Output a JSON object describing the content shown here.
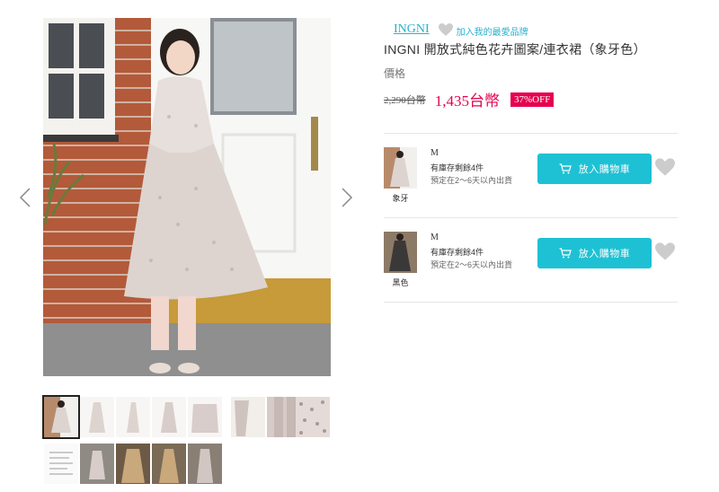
{
  "brand": {
    "name": "INGNI",
    "favorite_label": "加入我的最愛品牌"
  },
  "product": {
    "title": "INGNI 開放式純色花卉圖案/連衣裙（象牙色）",
    "price_label": "價格",
    "original_price": "2,290台幣",
    "sale_price": "1,435台幣",
    "discount": "37%OFF"
  },
  "variants": [
    {
      "color": "象牙",
      "size": "M",
      "stock": "有庫存剩餘4件",
      "eta": "預定在2～6天以內出貨",
      "cart_label": "放入購物車"
    },
    {
      "color": "黑色",
      "size": "M",
      "stock": "有庫存剩餘4件",
      "eta": "預定在2～6天以內出貨",
      "cart_label": "放入購物車"
    }
  ],
  "gallery": {
    "selected_index": 0,
    "thumbnail_count": 15
  },
  "colors": {
    "accent": "#2ab1cc",
    "cart_button": "#1ec1d4",
    "sale_red": "#e5004f",
    "heart_gray": "#cccccc"
  },
  "icons": {
    "gallery_prev": "chevron-left-icon",
    "gallery_next": "chevron-right-icon",
    "favorite": "heart-icon",
    "cart": "cart-icon"
  }
}
